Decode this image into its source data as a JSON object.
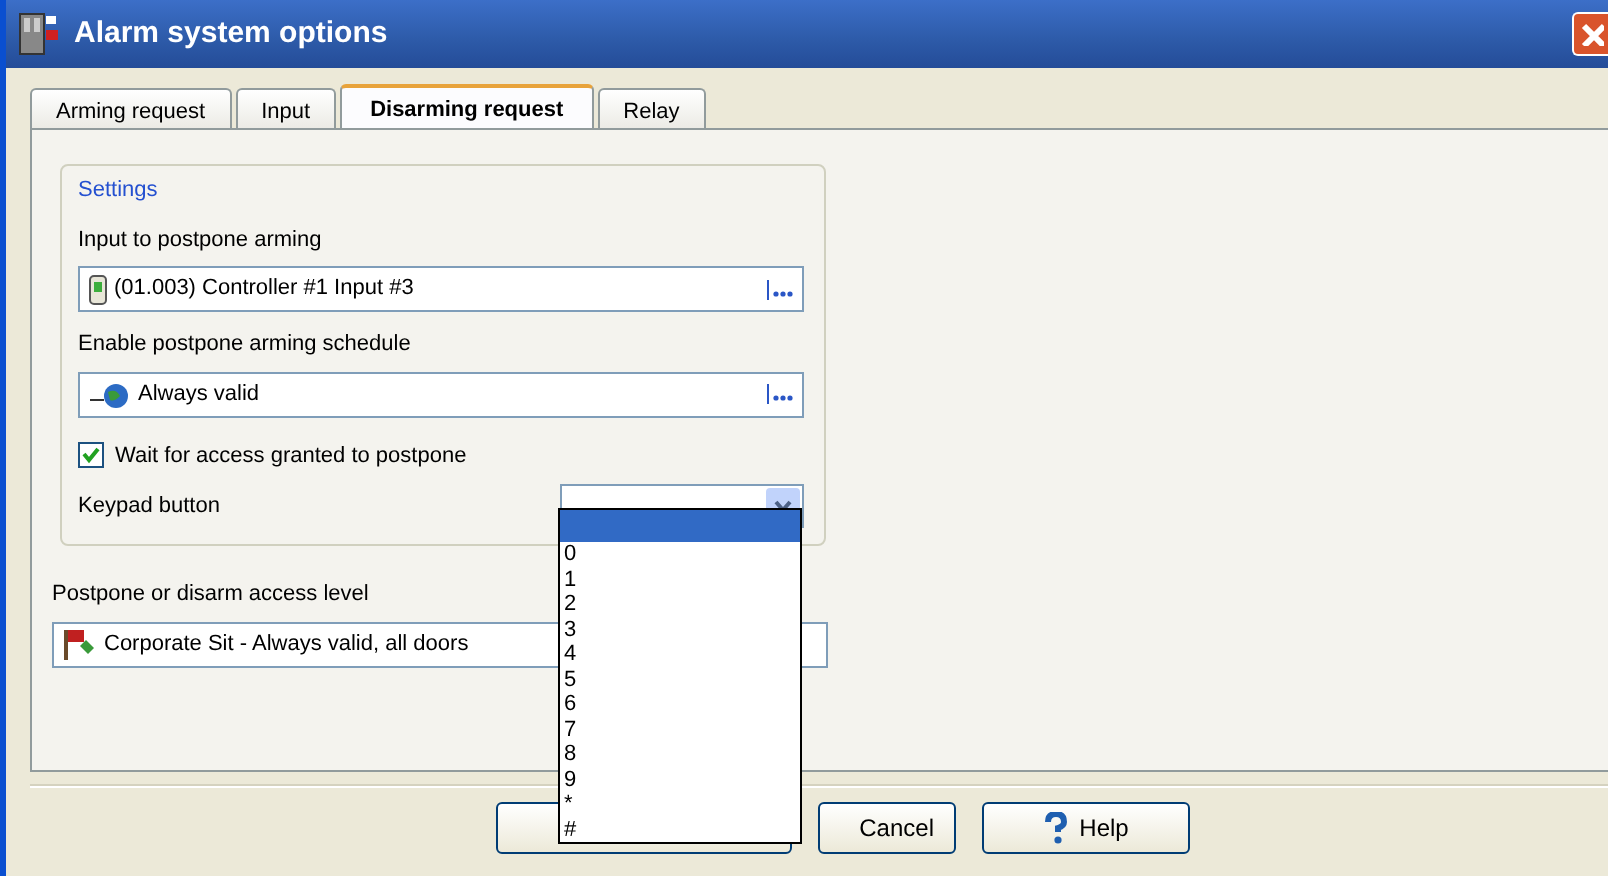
{
  "window": {
    "title": "Alarm system options"
  },
  "tabs": [
    {
      "label": "Arming request",
      "selected": false
    },
    {
      "label": "Input",
      "selected": false
    },
    {
      "label": "Disarming request",
      "selected": true
    },
    {
      "label": "Relay",
      "selected": false
    }
  ],
  "settings_group": {
    "title": "Settings",
    "fields": [
      {
        "kind": "input",
        "label": "Input to postpone arming",
        "value": "(01.003) Controller #1 Input #3"
      },
      {
        "kind": "schedule",
        "label": "Enable postpone arming schedule",
        "value": "Always valid"
      },
      {
        "kind": "checkbox",
        "label": "Wait for access granted to postpone",
        "checked": true
      },
      {
        "kind": "combo",
        "label": "Keypad button",
        "expanded": true
      }
    ]
  },
  "access_level": {
    "label": "Postpone or disarm access level",
    "value": "Corporate Sit - Always valid, all doors"
  },
  "dropdown": {
    "items": [
      {
        "selected": true
      },
      {
        "label": "0",
        "selected": false
      },
      {
        "label": "1",
        "selected": false
      },
      {
        "label": "2",
        "selected": false
      },
      {
        "label": "3",
        "selected": false
      },
      {
        "label": "4",
        "selected": false
      },
      {
        "label": "5",
        "selected": false
      },
      {
        "label": "6",
        "selected": false
      },
      {
        "label": "7",
        "selected": false
      },
      {
        "label": "8",
        "selected": false
      },
      {
        "label": "9",
        "selected": false
      },
      {
        "label": "*",
        "selected": false
      },
      {
        "label": "#",
        "selected": false
      }
    ]
  },
  "buttons": [
    {
      "kind": "blank"
    },
    {
      "kind": "cancel",
      "label": "Cancel"
    },
    {
      "kind": "help",
      "label": "Help"
    }
  ]
}
